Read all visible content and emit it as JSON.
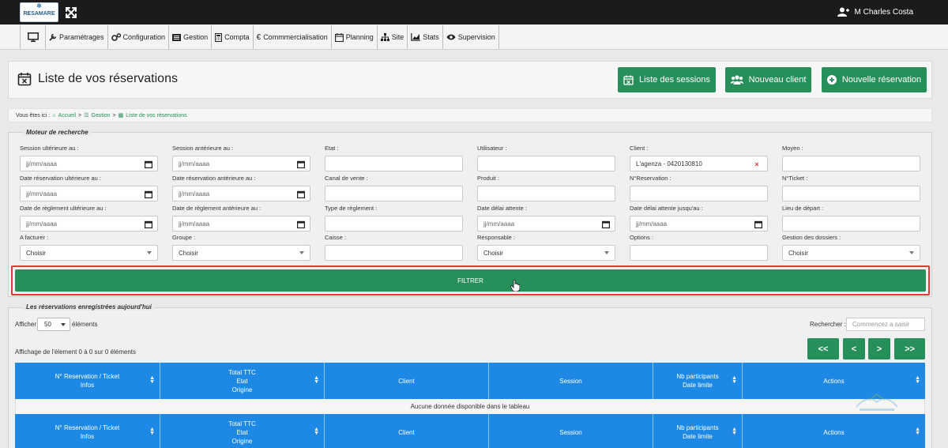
{
  "brand": {
    "logo_text": "RESAMARE"
  },
  "header": {
    "user_name": "M Charles Costa"
  },
  "menu": [
    {
      "label": "",
      "icon": "monitor-icon"
    },
    {
      "label": "Paramétrages",
      "icon": "wrench-icon"
    },
    {
      "label": "Configuration",
      "icon": "cogs-icon"
    },
    {
      "label": "Gestion",
      "icon": "list-icon"
    },
    {
      "label": "Compta",
      "icon": "calculator-icon"
    },
    {
      "label": "Commmercialisation",
      "icon": "euro-icon"
    },
    {
      "label": "Planning",
      "icon": "calendar-icon"
    },
    {
      "label": "Site",
      "icon": "sitemap-icon"
    },
    {
      "label": "Stats",
      "icon": "chart-icon"
    },
    {
      "label": "Supervision",
      "icon": "eye-icon"
    }
  ],
  "page": {
    "title": "Liste de vos réservations"
  },
  "actions": {
    "sessions": "Liste des sessions",
    "new_client": "Nouveau client",
    "new_reservation": "Nouvelle réservation"
  },
  "breadcrumb": {
    "prefix": "Vous êtes ici :",
    "home": "Accueil",
    "sep": ">",
    "gestion": "Gestion",
    "current": "Liste de vos réservations"
  },
  "search_engine": {
    "legend": "Moteur de recherche",
    "fields": [
      {
        "label": "Session ultérieure au :",
        "value": "jj/mm/aaaa",
        "kind": "date"
      },
      {
        "label": "Session antérieure au :",
        "value": "jj/mm/aaaa",
        "kind": "date"
      },
      {
        "label": "Etat :",
        "value": "",
        "kind": "text"
      },
      {
        "label": "Utilisateur :",
        "value": "",
        "kind": "text"
      },
      {
        "label": "Client :",
        "value": "L'agenza - 0420130810",
        "kind": "clear"
      },
      {
        "label": "Moyen :",
        "value": "",
        "kind": "text"
      },
      {
        "label": "Date réservation ultérieure au :",
        "value": "jj/mm/aaaa",
        "kind": "date"
      },
      {
        "label": "Date réservation antérieure au :",
        "value": "jj/mm/aaaa",
        "kind": "date"
      },
      {
        "label": "Canal de vente :",
        "value": "",
        "kind": "text"
      },
      {
        "label": "Produit :",
        "value": "",
        "kind": "text"
      },
      {
        "label": "N°Reservation :",
        "value": "",
        "kind": "text"
      },
      {
        "label": "N°Ticket :",
        "value": "",
        "kind": "text"
      },
      {
        "label": "Date de règlement ultérieure au :",
        "value": "jj/mm/aaaa",
        "kind": "date"
      },
      {
        "label": "Date de règlement antérieure au :",
        "value": "jj/mm/aaaa",
        "kind": "date"
      },
      {
        "label": "Type de règlement :",
        "value": "",
        "kind": "text"
      },
      {
        "label": "Date délai attente :",
        "value": "jj/mm/aaaa",
        "kind": "date"
      },
      {
        "label": "Date délai attente jusqu'au :",
        "value": "jj/mm/aaaa",
        "kind": "date"
      },
      {
        "label": "Lieu de départ :",
        "value": "",
        "kind": "text"
      },
      {
        "label": "A facturer :",
        "value": "Choisir",
        "kind": "select"
      },
      {
        "label": "Groupe :",
        "value": "Choisir",
        "kind": "select"
      },
      {
        "label": "Caisse :",
        "value": "",
        "kind": "text"
      },
      {
        "label": "Responsable :",
        "value": "Choisir",
        "kind": "select"
      },
      {
        "label": "Options :",
        "value": "",
        "kind": "text"
      },
      {
        "label": "Gestion des dossiers :",
        "value": "Choisir",
        "kind": "select"
      }
    ],
    "filter_button": "FILTRER"
  },
  "results": {
    "legend": "Les réservations enregistrées aujourd'hui",
    "show_prefix": "Afficher",
    "page_size": "50",
    "show_suffix": "éléments",
    "search_label": "Rechercher :",
    "search_placeholder": "Commencez a saisir",
    "info": "Affichage de l'élement 0 à 0 sur 0 éléments",
    "pager": {
      "first": "<<",
      "prev": "<",
      "next": ">",
      "last": ">>"
    },
    "columns": [
      {
        "lines": [
          "N° Reservation / Ticket",
          "Infos"
        ],
        "sortable": true
      },
      {
        "lines": [
          "Total TTC",
          "Etat",
          "Origine"
        ],
        "sortable": true
      },
      {
        "lines": [
          "Client"
        ],
        "sortable": false
      },
      {
        "lines": [
          "Session"
        ],
        "sortable": false
      },
      {
        "lines": [
          "Nb participants",
          "Date limite"
        ],
        "sortable": true
      },
      {
        "lines": [
          "Actions"
        ],
        "sortable": true
      }
    ],
    "empty_message": "Aucune donnée disponible dans le tableau"
  }
}
